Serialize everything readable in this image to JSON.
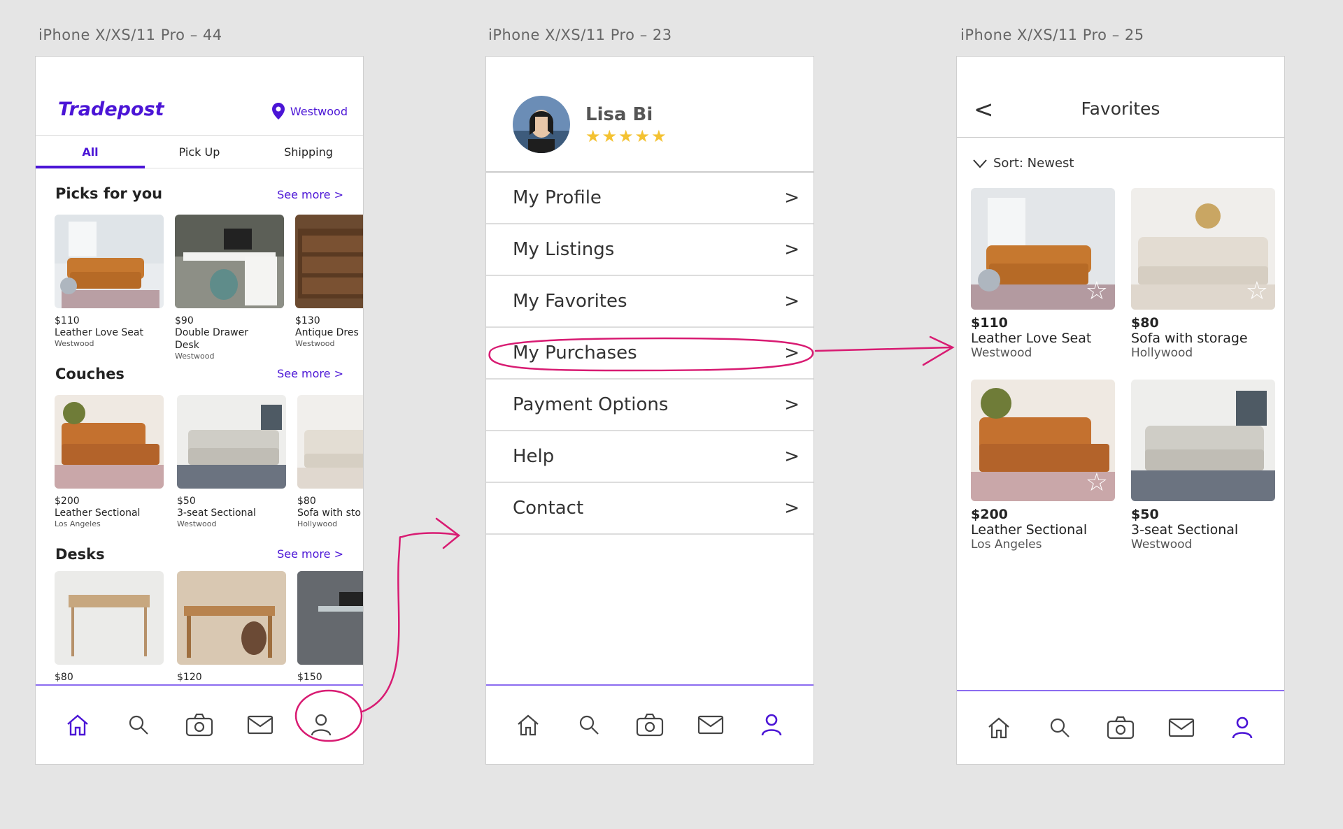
{
  "frames": [
    {
      "label": "iPhone X/XS/11 Pro – 44"
    },
    {
      "label": "iPhone X/XS/11 Pro – 23"
    },
    {
      "label": "iPhone X/XS/11 Pro – 25"
    }
  ],
  "home": {
    "brand": "Tradepost",
    "location": "Westwood",
    "tabs": [
      "All",
      "Pick Up",
      "Shipping"
    ],
    "sections": [
      {
        "title": "Picks for you",
        "see_more": "See more >",
        "items": [
          {
            "price": "$110",
            "title": "Leather Love Seat",
            "location": "Westwood"
          },
          {
            "price": "$90",
            "title": "Double Drawer",
            "title2": "Desk",
            "location": "Westwood"
          },
          {
            "price": "$130",
            "title": "Antique Dres",
            "location": "Westwood"
          }
        ]
      },
      {
        "title": "Couches",
        "see_more": "See more >",
        "items": [
          {
            "price": "$200",
            "title": "Leather Sectional",
            "location": "Los Angeles"
          },
          {
            "price": "$50",
            "title": "3-seat Sectional",
            "location": "Westwood"
          },
          {
            "price": "$80",
            "title": "Sofa with sto",
            "location": "Hollywood"
          }
        ]
      },
      {
        "title": "Desks",
        "see_more": "See more >",
        "items": [
          {
            "price": "$80"
          },
          {
            "price": "$120"
          },
          {
            "price": "$150"
          }
        ]
      }
    ]
  },
  "profile": {
    "name": "Lisa Bi",
    "stars": "★★★★★",
    "menu": [
      "My Profile",
      "My Listings",
      "My Favorites",
      "My Purchases",
      "Payment Options",
      "Help",
      "Contact"
    ],
    "chevron": ">"
  },
  "favorites": {
    "back": "<",
    "title": "Favorites",
    "sort": "Sort: Newest",
    "items": [
      {
        "price": "$110",
        "title": "Leather Love Seat",
        "location": "Westwood"
      },
      {
        "price": "$80",
        "title": "Sofa with storage",
        "location": "Hollywood"
      },
      {
        "price": "$200",
        "title": "Leather Sectional",
        "location": "Los Angeles"
      },
      {
        "price": "$50",
        "title": "3-seat Sectional",
        "location": "Westwood"
      }
    ]
  },
  "colors": {
    "accent": "#4b15d6",
    "annotation": "#d81b72",
    "star": "#f4c232"
  }
}
